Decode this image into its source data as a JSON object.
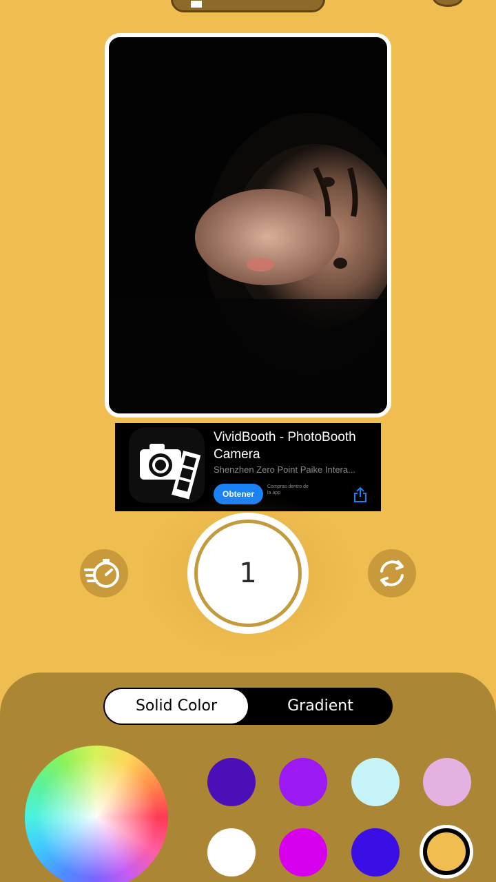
{
  "top_bar": {
    "mode_icon": "mode-icon",
    "right_icon": "settings-icon"
  },
  "ad": {
    "title": "VividBooth - PhotoBooth Camera",
    "developer": "Shenzhen Zero Point Paike Intera...",
    "get_label": "Obtener",
    "in_app_note": "Compras dentro de la app",
    "icon": "camera-filmstrip-icon",
    "share_icon": "share-icon"
  },
  "camera": {
    "shutter_count": "1",
    "left_icon": "timer-icon",
    "right_icon": "flip-camera-icon"
  },
  "panel": {
    "tabs": [
      "Solid Color",
      "Gradient"
    ],
    "active_tab": "Solid Color",
    "swatches": [
      "#4B0FB8",
      "#9B19F2",
      "#C6F4F8",
      "#E3B2E0",
      "#FFFFFF",
      "#D600EE",
      "#3A0FE6",
      "#F0BE50"
    ],
    "selected_swatch": "#F0BE50"
  },
  "colors": {
    "background": "#F0BE50",
    "panel": "#AB8634",
    "accent": "#C49A3E",
    "button_blue": "#1A82F5"
  }
}
